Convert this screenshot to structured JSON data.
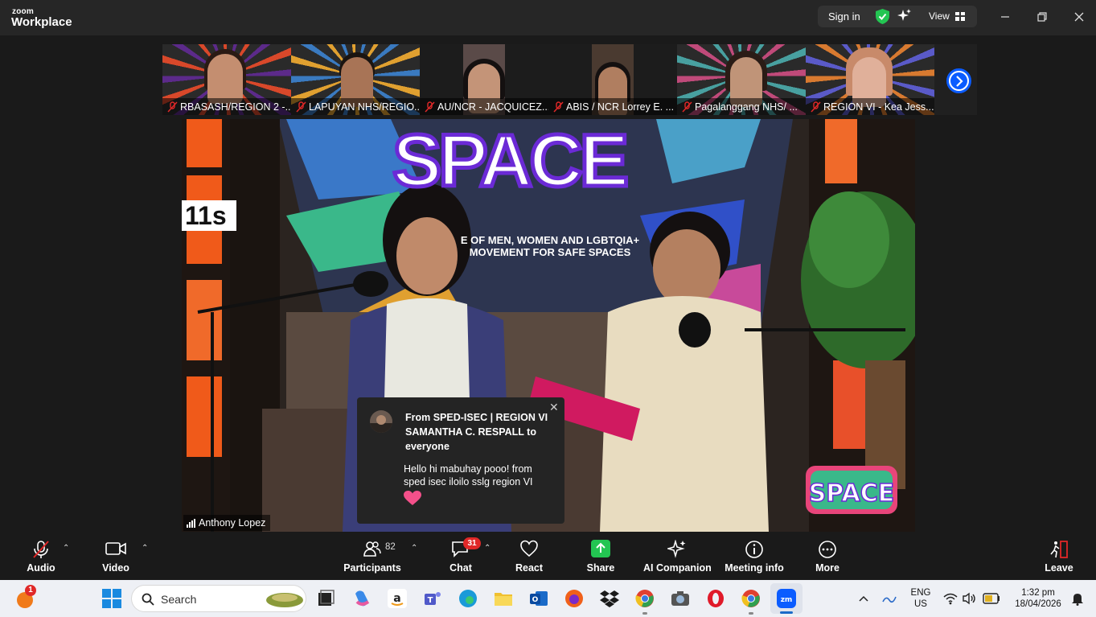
{
  "titlebar": {
    "logo_top": "zoom",
    "logo_bottom": "Workplace",
    "sign_in": "Sign in",
    "view": "View"
  },
  "participants_strip": [
    {
      "name": "RBASASH/REGION 2 -..."
    },
    {
      "name": "LAPUYAN NHS/REGIO..."
    },
    {
      "name": "AU/NCR - JACQUICEZ..."
    },
    {
      "name": "ABIS / NCR Lorrey E. ..."
    },
    {
      "name": "Pagalanggang NHS/ ..."
    },
    {
      "name": "REGION VI - Kea Jess..."
    }
  ],
  "video": {
    "timer": "11s",
    "speaker_name": "Anthony Lopez",
    "banner_title": "SPACE",
    "banner_subtitle": "E OF MEN, WOMEN AND LGBTQIA+ MOVEMENT FOR SAFE SPACES"
  },
  "chat_popup": {
    "header": "From SPED-ISEC | REGION VI SAMANTHA C. RESPALL to everyone",
    "message": "Hello hi mabuhay pooo! from sped isec iloilo sslg region VI"
  },
  "toolbar": {
    "audio": "Audio",
    "video": "Video",
    "participants": "Participants",
    "participants_count": "82",
    "chat": "Chat",
    "chat_badge": "31",
    "react": "React",
    "share": "Share",
    "ai_companion": "AI Companion",
    "meeting_info": "Meeting info",
    "more": "More",
    "leave": "Leave"
  },
  "taskbar": {
    "notification_badge": "1",
    "search_placeholder": "Search",
    "lang_top": "ENG",
    "lang_bottom": "US",
    "time": "1:32 pm",
    "date": "18/04/2026"
  },
  "colors": {
    "accent_blue": "#0b5cff",
    "share_green": "#23c552",
    "muted_red": "#e02828",
    "toolbar_bg": "#1a1a1a"
  }
}
